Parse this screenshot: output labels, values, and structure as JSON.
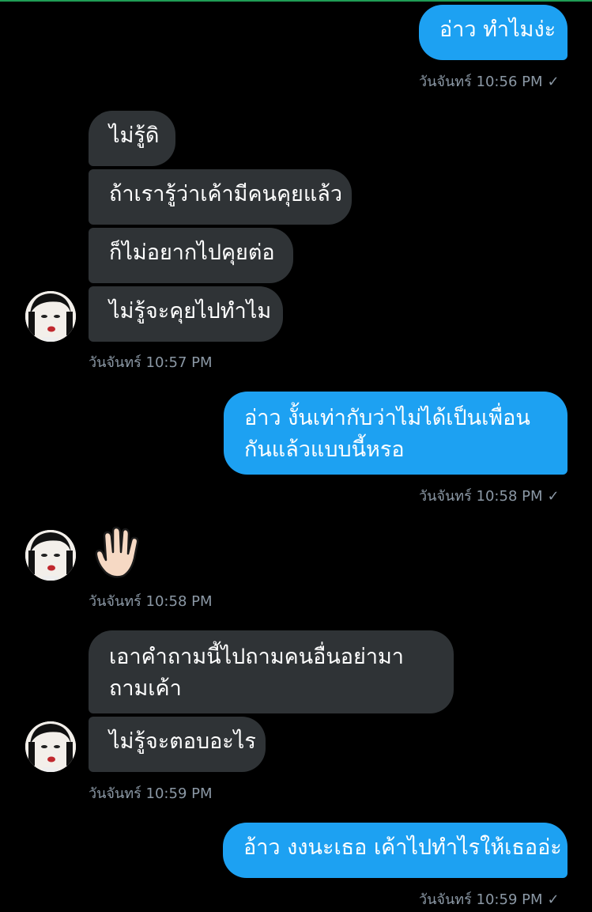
{
  "messages": {
    "m1": "อ่าว ทำไมง่ะ",
    "t1": "วันจันทร์ 10:56 PM",
    "m2": "ไม่รู้ดิ",
    "m3": "ถ้าเรารู้ว่าเค้ามีคนคุยแล้ว",
    "m4": "ก็ไม่อยากไปคุยต่อ",
    "m5": "ไม่รู้จะคุยไปทำไม",
    "t2": "วันจันทร์ 10:57 PM",
    "m6": "อ่าว งั้นเท่ากับว่าไม่ได้เป็นเพื่อนกันแล้วแบบนี้หรอ",
    "t3": "วันจันทร์ 10:58 PM",
    "m7": "🖐🏻",
    "t4": "วันจันทร์ 10:58 PM",
    "m8": "เอาคำถามนี้ไปถามคนอื่นอย่ามาถามเค้า",
    "m9": "ไม่รู้จะตอบอะไร",
    "t5": "วันจันทร์ 10:59 PM",
    "m10": "อ้าว งงนะเธอ เค้าไปทำไรให้เธออ่ะ",
    "t6": "วันจันทร์ 10:59 PM"
  },
  "check": "✓",
  "colors": {
    "outgoing": "#1da1f2",
    "incoming": "#2f3336",
    "background": "#000000",
    "timestamp": "#8b98a5"
  }
}
